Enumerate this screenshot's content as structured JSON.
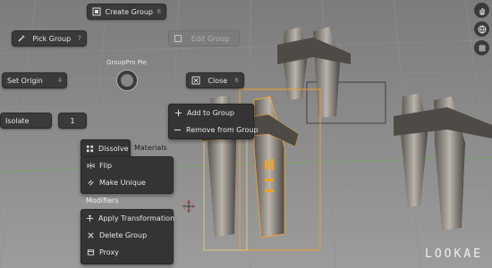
{
  "pie_title": "GroupPro Pie",
  "buttons": {
    "create_group": {
      "label": "Create Group",
      "key": "8"
    },
    "pick_group": {
      "label": "Pick Group",
      "key": "7"
    },
    "edit_group": {
      "label": "Edit Group"
    },
    "set_origin": {
      "label": "Set Origin",
      "key": "4"
    },
    "close": {
      "label": "Close",
      "key": "6"
    },
    "isolate": {
      "label": "Isolate"
    },
    "isolate_value": "1"
  },
  "group_menu": {
    "items": [
      {
        "label": "Add to Group"
      },
      {
        "label": "Remove from Group"
      }
    ]
  },
  "left_menu": {
    "dissolve": "Dissolve",
    "materials": "Materials",
    "flip": "Flip",
    "make_unique": "Make Unique",
    "modifiers": "Modifiers",
    "apply_transformation": "Apply Transformation",
    "delete_group": "Delete Group",
    "proxy": "Proxy"
  },
  "watermark": "LOOKAE",
  "icons": [
    "hand-icon",
    "globe-icon",
    "grid-icon",
    "eyedropper-icon",
    "group-icon",
    "plus-icon",
    "minus-icon"
  ],
  "colors": {
    "selection": "#f2a127",
    "menu_bg": "#343434",
    "grid": "#9a9a9a"
  }
}
